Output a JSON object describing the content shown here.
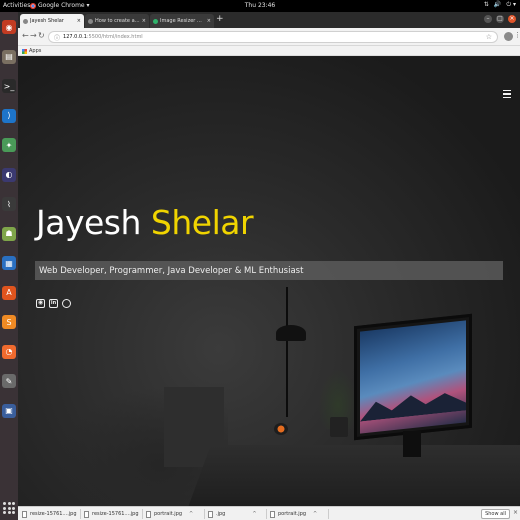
{
  "topbar": {
    "activities": "Activities",
    "app_name": "Google Chrome ▾",
    "clock": "Thu 23:46",
    "tray": [
      "⇅",
      "🔊",
      "⏻ ▾"
    ]
  },
  "dock": {
    "icons": [
      "chrome-icon",
      "files-icon",
      "terminal-icon",
      "vscode-icon",
      "android-studio-icon",
      "eclipse-icon",
      "system-monitor-icon",
      "android-icon",
      "writer-icon",
      "ubuntu-software-icon",
      "sublime-icon",
      "postman-icon",
      "inkscape-icon",
      "virtualbox-icon"
    ],
    "colors": [
      "#c23b22",
      "#7a6f61",
      "#2a2a2a",
      "#1e74c9",
      "#4a9a58",
      "#3b3970",
      "#3a3a3a",
      "#7fa54a",
      "#2a6fc1",
      "#e0541e",
      "#f08a24",
      "#f06a2e",
      "#6a6a6a",
      "#3a5e9c"
    ]
  },
  "tabs": [
    {
      "label": "Jayesh Shelar",
      "active": true
    },
    {
      "label": "How to create an image ...",
      "active": false
    },
    {
      "label": "Image Resizer Online - Re...",
      "active": false
    }
  ],
  "window_controls": [
    "–",
    "□",
    "×"
  ],
  "omnibox": {
    "host": "127.0.0.1",
    "path": ":5500/html/index.html"
  },
  "bookmarks": {
    "apps_label": "Apps"
  },
  "page": {
    "name_first": "Jayesh",
    "name_last": "Shelar",
    "tagline": "Web Developer, Programmer, Java Developer & ML Enthusiast",
    "social": [
      "instagram-icon",
      "linkedin-icon",
      "github-icon"
    ],
    "accent": "#f0d400"
  },
  "downloads": {
    "items": [
      "resize-15761....jpg",
      "resize-15761....jpg",
      "portrait.jpg",
      ".jpg",
      "portrait.jpg"
    ],
    "show_all": "Show all"
  }
}
